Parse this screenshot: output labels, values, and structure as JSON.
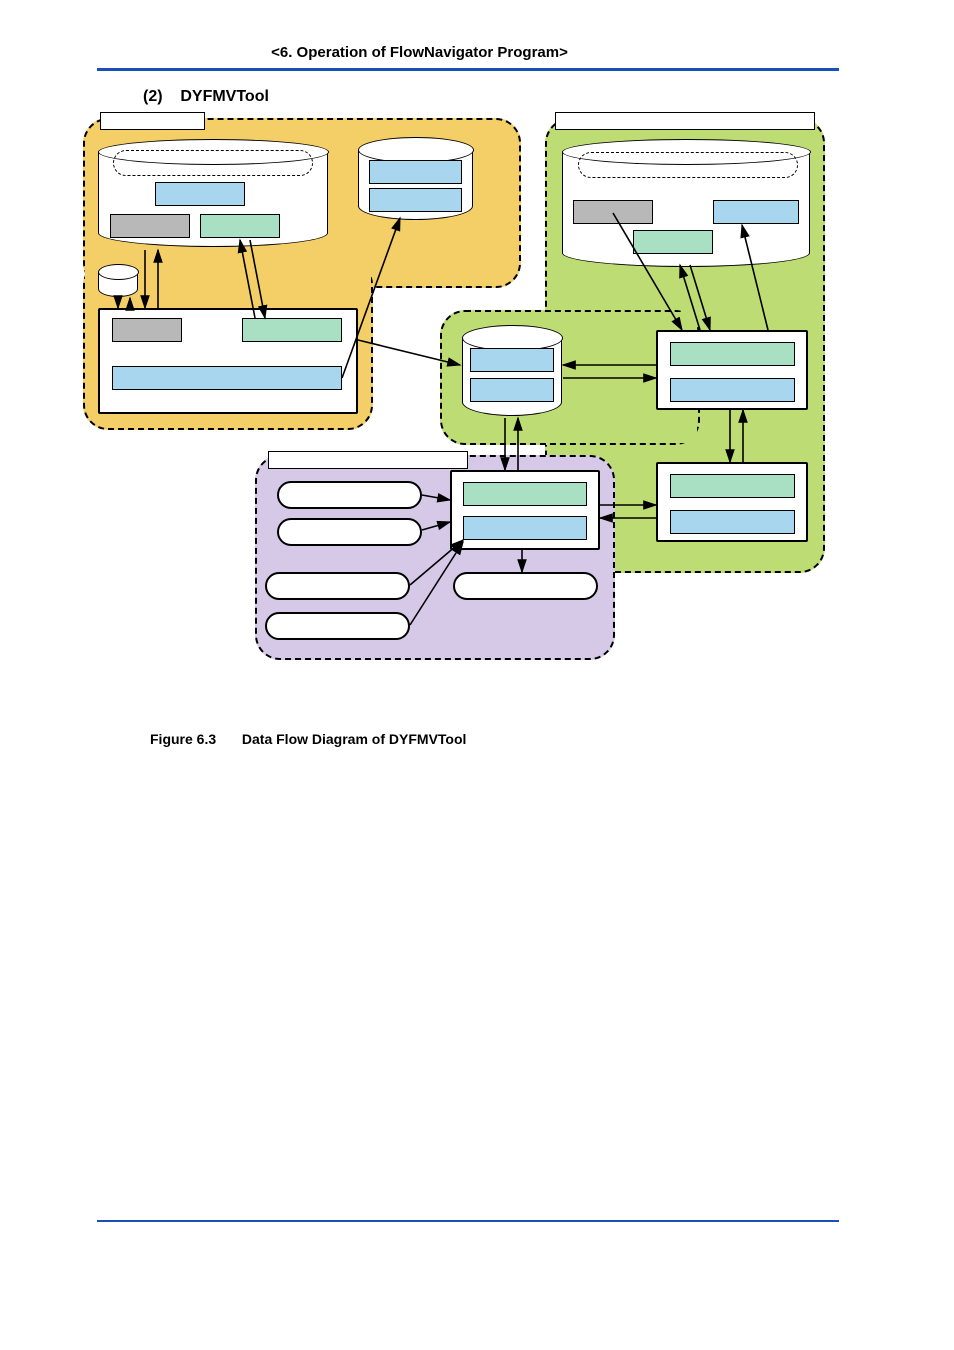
{
  "header": {
    "text": "<6.  Operation of FlowNavigator Program>"
  },
  "section": {
    "number": "(2)",
    "title": "DYFMVTool"
  },
  "caption": {
    "label": "Figure 6.3",
    "text": "Data Flow Diagram of DYFMVTool"
  },
  "diagram": {
    "regions": {
      "yellow": {
        "label": ""
      },
      "green": {
        "label": ""
      },
      "purple": {
        "label": ""
      }
    },
    "blocks": {
      "cylinder_top_left": {
        "label": ""
      },
      "cylinder_top_mid": {
        "label": ""
      },
      "cylinder_top_right": {
        "label": ""
      },
      "cylinder_small": {
        "label": ""
      },
      "cylinder_center": {
        "label": ""
      },
      "unit_yellow_bottom": {
        "label": ""
      },
      "unit_green_mid": {
        "label": ""
      },
      "unit_green_bottom": {
        "label": ""
      },
      "unit_purple": {
        "label": ""
      }
    },
    "tablets": {
      "t1": {
        "label": ""
      },
      "t2": {
        "label": ""
      },
      "t3": {
        "label": ""
      },
      "t4": {
        "label": ""
      },
      "t5": {
        "label": ""
      }
    }
  }
}
